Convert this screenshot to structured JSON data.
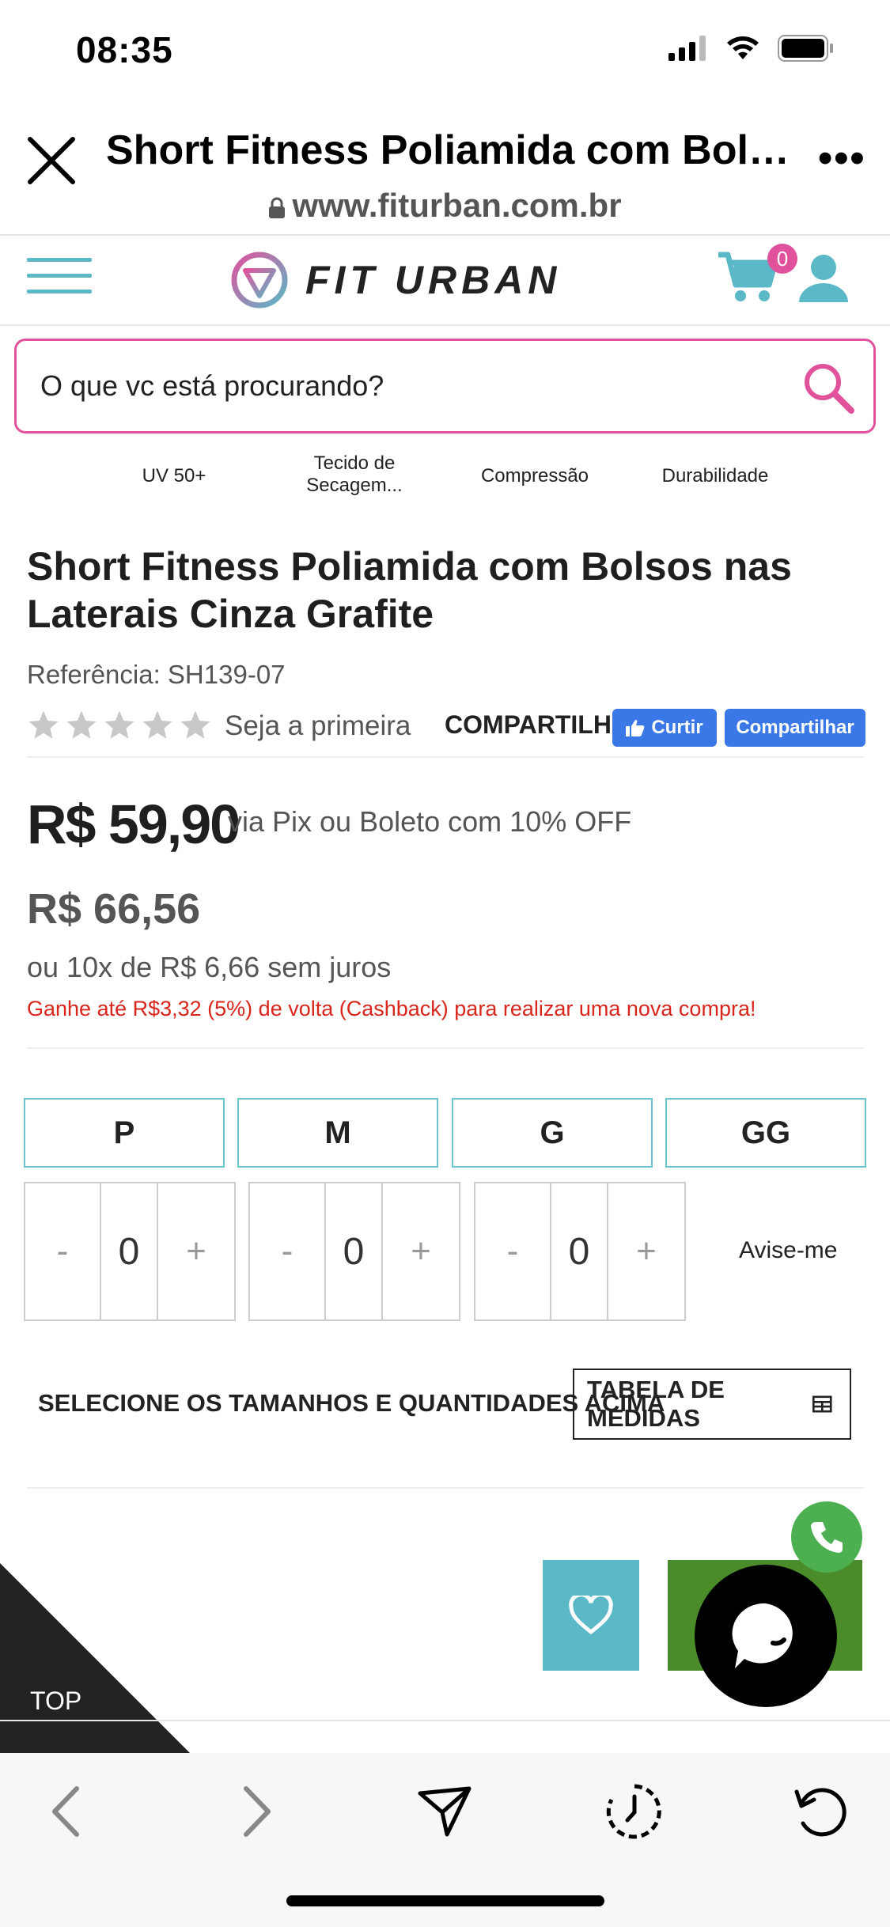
{
  "status_bar": {
    "time": "08:35"
  },
  "browser": {
    "title": "Short Fitness Poliamida com Bolsos nas Laterais Cinza Grafite",
    "url": "www.fiturban.com.br"
  },
  "site": {
    "logo_text": "FIT URBAN",
    "cart_count": "0",
    "search_placeholder": "O que vc está procurando?",
    "features": [
      "UV 50+",
      "Tecido de Secagem...",
      "Compressão",
      "Durabilidade"
    ]
  },
  "product": {
    "title": "Short Fitness Poliamida com Bolsos nas Laterais Cinza Grafite",
    "reference": "Referência: SH139-07",
    "rating": 0,
    "rating_text": "Seja a primeira",
    "share_label": "COMPARTILHE:",
    "like_label": "Curtir",
    "share_button_label": "Compartilhar",
    "price": "R$ 59,90",
    "price_note": "via Pix ou Boleto com 10% OFF",
    "old_price": "R$ 66,56",
    "installments": "ou 10x de R$ 6,66 sem juros",
    "cashback": "Ganhe até R$3,32 (5%) de volta (Cashback) para realizar uma nova compra!"
  },
  "sizes": [
    {
      "label": "P",
      "minus": "-",
      "qty": "0",
      "plus": "+"
    },
    {
      "label": "M",
      "minus": "-",
      "qty": "0",
      "plus": "+"
    },
    {
      "label": "G",
      "minus": "-",
      "qty": "0",
      "plus": "+"
    },
    {
      "label": "GG",
      "notify": "Avise-me"
    }
  ],
  "select_message": "SELECIONE OS TAMANHOS E QUANTIDADES ACIMA",
  "size_table_label": "TABELA DE MEDIDAS",
  "top_label": "TOP",
  "colors": {
    "accent_teal": "#5bb8c6",
    "brand_pink": "#e0529c",
    "buy_green": "#4a8c2a",
    "cashback_red": "#d9261c",
    "facebook_blue": "#3b78e7"
  }
}
